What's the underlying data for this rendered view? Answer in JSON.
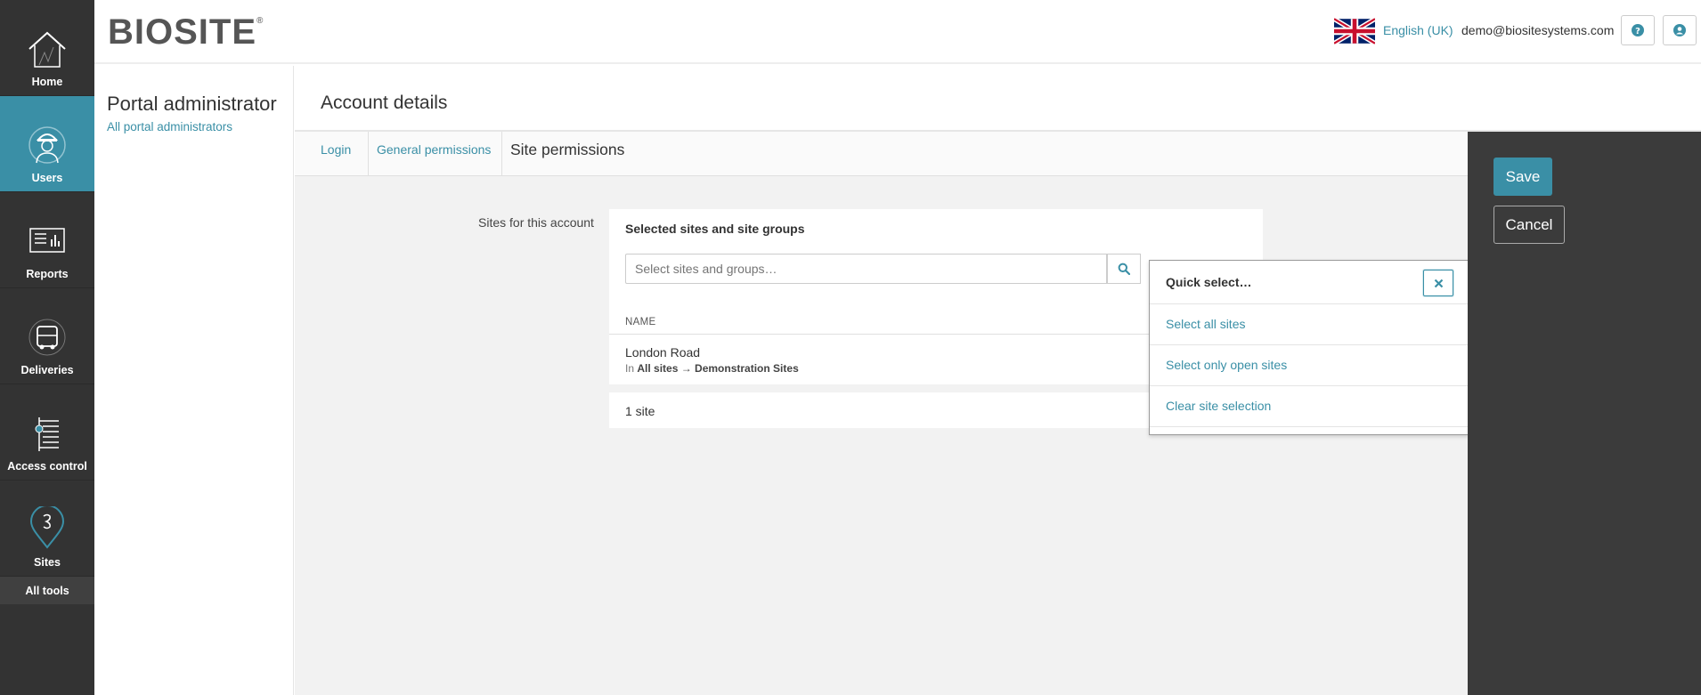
{
  "nav": {
    "items": [
      {
        "label": "Home",
        "icon": "house-icon"
      },
      {
        "label": "Users",
        "icon": "worker-icon"
      },
      {
        "label": "Reports",
        "icon": "reports-icon"
      },
      {
        "label": "Deliveries",
        "icon": "truck-icon"
      },
      {
        "label": "Access control",
        "icon": "turnstile-icon"
      },
      {
        "label": "Sites",
        "icon": "map-pin-icon"
      }
    ],
    "all_tools": "All tools",
    "active": "Users"
  },
  "header": {
    "logo": "BIOSITE",
    "logo_mark": "®",
    "language": "English (UK)",
    "email": "demo@biositesystems.com",
    "help_icon": "question-circle-icon",
    "account_icon": "user-circle-icon"
  },
  "sidebar": {
    "title": "Portal administrator",
    "link": "All portal administrators"
  },
  "page": {
    "title": "Account details",
    "tabs": [
      {
        "label": "Login"
      },
      {
        "label": "General permissions"
      },
      {
        "label": "Site permissions"
      }
    ],
    "active_tab": "Site permissions"
  },
  "site_permissions": {
    "field_label": "Sites for this account",
    "panel_title": "Selected sites and site groups",
    "search_placeholder": "Select sites and groups…",
    "column_name": "NAME",
    "rows": [
      {
        "name": "London Road",
        "path_prefix": "In",
        "path": "All sites → Demonstration Sites"
      }
    ],
    "count": "1 site"
  },
  "quick_select": {
    "title": "Quick select…",
    "items": [
      {
        "label": "Select all sites"
      },
      {
        "label": "Select only open sites"
      },
      {
        "label": "Clear site selection"
      }
    ]
  },
  "actions": {
    "save": "Save",
    "cancel": "Cancel"
  },
  "colors": {
    "accent": "#3a8fa6",
    "rail": "#333333",
    "action_panel": "#3b3b3b",
    "content_bg": "#f2f2f2"
  }
}
